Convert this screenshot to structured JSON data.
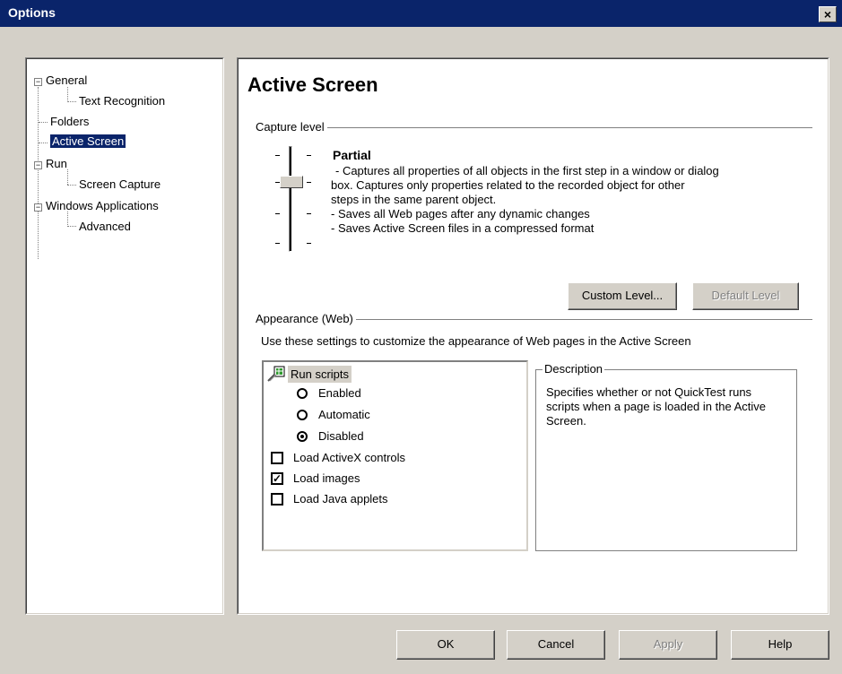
{
  "window": {
    "title": "Options",
    "close_glyph": "×"
  },
  "tree": {
    "items": [
      {
        "label": "General",
        "expander": "−"
      },
      {
        "label": "Text Recognition"
      },
      {
        "label": "Folders"
      },
      {
        "label": "Active Screen",
        "selected": true
      },
      {
        "label": "Run",
        "expander": "−"
      },
      {
        "label": "Screen Capture"
      },
      {
        "label": "Windows Applications",
        "expander": "−"
      },
      {
        "label": "Advanced"
      }
    ]
  },
  "main": {
    "heading": "Active Screen",
    "capture": {
      "group_label": "Capture level",
      "level_name": "Partial",
      "desc_lines": [
        "- Captures all properties of all objects in the first step in a window or dialog",
        "box.  Captures only properties related to the recorded object for other",
        "steps in the same parent object.",
        "- Saves all Web pages after any dynamic changes",
        "- Saves Active Screen files in a compressed format"
      ],
      "custom_button": "Custom Level...",
      "default_button": "Default Level"
    },
    "appearance": {
      "group_label": "Appearance (Web)",
      "hint": "Use these settings to customize the appearance of Web pages in the Active Screen",
      "run_scripts_label": "Run scripts",
      "options": [
        {
          "label": "Enabled",
          "selected": false
        },
        {
          "label": "Automatic",
          "selected": false
        },
        {
          "label": "Disabled",
          "selected": true
        }
      ],
      "checkboxes": [
        {
          "label": "Load ActiveX controls",
          "checked": false,
          "mark": ""
        },
        {
          "label": "Load images",
          "checked": true,
          "mark": "✓"
        },
        {
          "label": "Load Java applets",
          "checked": false,
          "mark": ""
        }
      ],
      "description_label": "Description",
      "description_text": "Specifies whether or not QuickTest runs scripts when a page is loaded in the Active Screen."
    }
  },
  "footer": {
    "ok": "OK",
    "cancel": "Cancel",
    "apply": "Apply",
    "help": "Help"
  }
}
